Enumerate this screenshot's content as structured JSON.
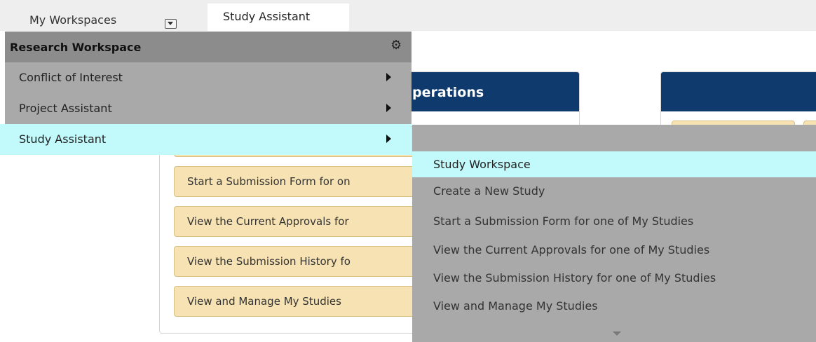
{
  "topbar": {
    "workspaces_label": "My Workspaces",
    "active_tab": "Study Assistant"
  },
  "panel": {
    "title_partial": "perations"
  },
  "action_buttons": [
    "Start a Submission Form for on",
    "View the Current Approvals for",
    "View the Submission History fo",
    "View and Manage My Studies"
  ],
  "menu": {
    "header": "Research Workspace",
    "settings_icon": "gear-icon",
    "items": [
      {
        "label": "Conflict of Interest",
        "highlighted": false
      },
      {
        "label": "Project Assistant",
        "highlighted": false
      },
      {
        "label": "Study Assistant",
        "highlighted": true
      }
    ]
  },
  "submenu": {
    "items": [
      {
        "label": "Study Workspace",
        "highlighted": true
      },
      {
        "label": "Create a New Study",
        "highlighted": false
      },
      {
        "label": "Start a Submission Form for one of My Studies",
        "highlighted": false
      },
      {
        "label": "View the Current Approvals for one of My Studies",
        "highlighted": false
      },
      {
        "label": "View the Submission History for one of My Studies",
        "highlighted": false
      },
      {
        "label": "View and Manage My Studies",
        "highlighted": false
      }
    ]
  },
  "colors": {
    "header_navy": "#0e3a6d",
    "button_tan": "#f6e2b3",
    "menu_gray": "#a9a9a9",
    "menu_header_gray": "#8c8c8c",
    "highlight_cyan": "#c2fafc"
  }
}
